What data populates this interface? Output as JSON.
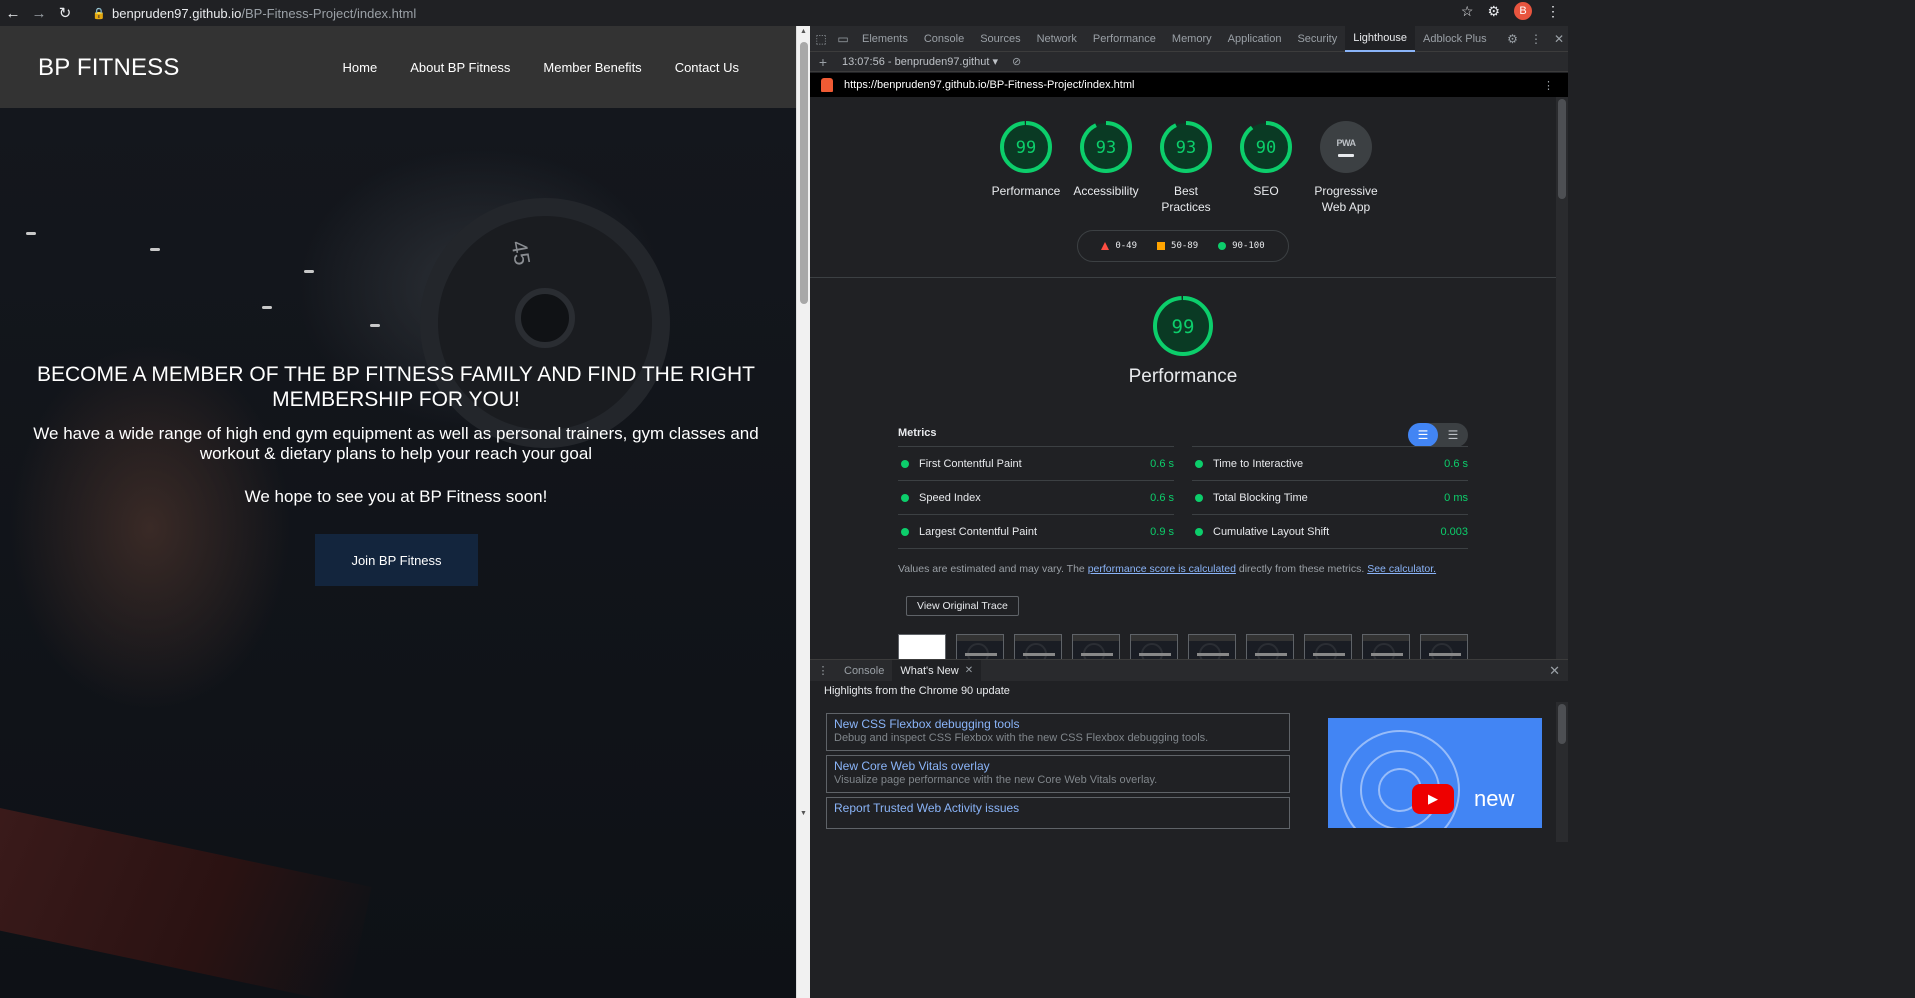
{
  "browser": {
    "url_host": "benpruden97.github.io",
    "url_path": "/BP-Fitness-Project/index.html",
    "avatar_letter": "B"
  },
  "site": {
    "brand": "BP FITNESS",
    "nav": [
      "Home",
      "About BP Fitness",
      "Member Benefits",
      "Contact Us"
    ],
    "hero_title": "BECOME A MEMBER OF THE BP FITNESS FAMILY AND FIND THE RIGHT MEMBERSHIP FOR YOU!",
    "hero_sub": "We have a wide range of high end gym equipment as well as personal trainers, gym classes and workout & dietary plans to help your reach your goal",
    "hero_sub2": "We hope to see you at BP Fitness soon!",
    "join_button": "Join BP Fitness",
    "plate_text": "45"
  },
  "devtools": {
    "tabs": [
      "Elements",
      "Console",
      "Sources",
      "Network",
      "Performance",
      "Memory",
      "Application",
      "Security",
      "Lighthouse",
      "Adblock Plus"
    ],
    "active_tab": "Lighthouse",
    "report_selector": "13:07:56 - benpruden97.githut",
    "report_url": "https://benpruden97.github.io/BP-Fitness-Project/index.html",
    "scores": [
      {
        "label": "Performance",
        "value": 99
      },
      {
        "label": "Accessibility",
        "value": 93
      },
      {
        "label": "Best Practices",
        "value": 93
      },
      {
        "label": "SEO",
        "value": 90
      }
    ],
    "pwa": {
      "label": "Progressive Web App",
      "badge": "PWA"
    },
    "legend": [
      "0-49",
      "50-89",
      "90-100"
    ],
    "perf_score": 99,
    "perf_title": "Performance",
    "metrics_title": "Metrics",
    "metrics": [
      {
        "label": "First Contentful Paint",
        "value": "0.6 s"
      },
      {
        "label": "Time to Interactive",
        "value": "0.6 s"
      },
      {
        "label": "Speed Index",
        "value": "0.6 s"
      },
      {
        "label": "Total Blocking Time",
        "value": "0 ms"
      },
      {
        "label": "Largest Contentful Paint",
        "value": "0.9 s"
      },
      {
        "label": "Cumulative Layout Shift",
        "value": "0.003"
      }
    ],
    "note_pre": "Values are estimated and may vary. The ",
    "note_link1": "performance score is calculated",
    "note_mid": " directly from these metrics. ",
    "note_link2": "See calculator.",
    "trace_button": "View Original Trace",
    "colors": {
      "pass": "#0cce6b",
      "average": "#ffa400",
      "fail": "#ff4e42",
      "pass_fill": "#0a3a24"
    }
  },
  "drawer": {
    "tabs": [
      "Console",
      "What's New"
    ],
    "active_tab": "What's New",
    "heading": "Highlights from the Chrome 90 update",
    "cards": [
      {
        "title": "New CSS Flexbox debugging tools",
        "desc": "Debug and inspect CSS Flexbox with the new CSS Flexbox debugging tools."
      },
      {
        "title": "New Core Web Vitals overlay",
        "desc": "Visualize page performance with the new Core Web Vitals overlay."
      },
      {
        "title": "Report Trusted Web Activity issues",
        "desc": ""
      }
    ],
    "video_text": "new"
  }
}
